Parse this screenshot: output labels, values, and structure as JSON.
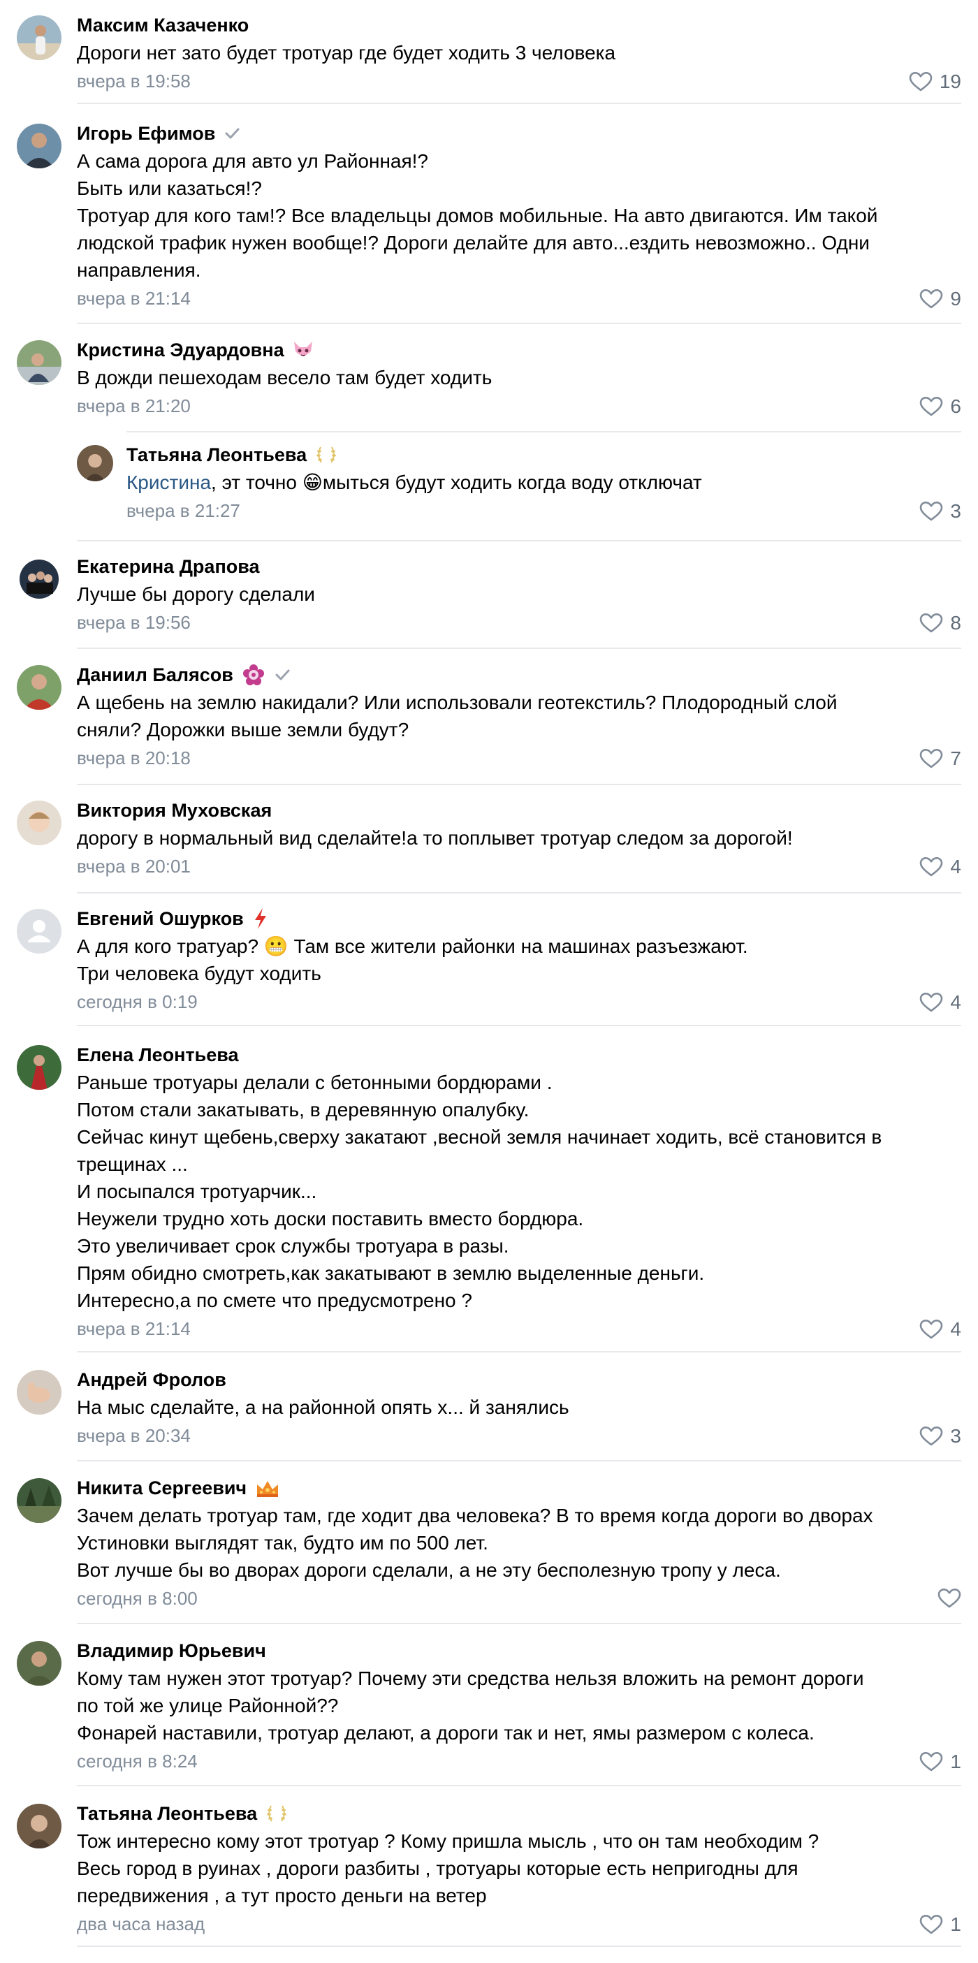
{
  "comments": [
    {
      "author": "Максим Казаченко",
      "text": "Дороги нет зато будет тротуар где будет ходить 3 человека",
      "time": "вчера в 19:58",
      "likes": "19",
      "avatar": "avatar-woman-beach"
    },
    {
      "author": "Игорь Ефимов",
      "verified": true,
      "text": "А сама дорога для авто ул Районная!?\nБыть или казаться!?\nТротуар для кого там!? Все владельцы домов мобильные. На авто двигаются. Им такой\nлюдской трафик нужен вообще!? Дороги делайте для авто...ездить невозможно.. Одни\nнаправления.",
      "time": "вчера в 21:14",
      "likes": "9",
      "avatar": "avatar-man-suit"
    },
    {
      "author": "Кристина Эдуардовна",
      "badge": "fox-mask-icon",
      "text": "В дожди пешеходам весело там будет ходить",
      "time": "вчера в 21:20",
      "likes": "6",
      "avatar": "avatar-woman-outdoor"
    },
    {
      "author": "Татьяна Леонтьева",
      "badge": "laurel-icon",
      "reply_to": "Кристина",
      "text": ", эт точно 😁мыться будут ходить когда воду отключат",
      "time": "вчера в 21:27",
      "likes": "3",
      "avatar": "avatar-woman-portrait",
      "reply": true
    },
    {
      "author": "Екатерина Драпова",
      "text": "Лучше бы дорогу сделали",
      "time": "вчера в 19:56",
      "likes": "8",
      "avatar": "avatar-group-photo"
    },
    {
      "author": "Даниил Балясов",
      "badge": "flower-badge-icon",
      "verified": true,
      "text": "А щебень на землю накидали? Или использовали геотекстиль? Плодородный слой\nсняли? Дорожки выше земли будут?",
      "time": "вчера в 20:18",
      "likes": "7",
      "avatar": "avatar-man-red"
    },
    {
      "author": "Виктория Муховская",
      "text": "дорогу в нормальный вид сделайте!а то поплывет тротуар следом за дорогой!",
      "time": "вчера в 20:01",
      "likes": "4",
      "avatar": "avatar-child"
    },
    {
      "author": "Евгений Ошурков",
      "badge": "lightning-icon",
      "text": "А для кого тратуар? 😬 Там все жители районки на машинах разъезжают.\nТри человека будут ходить",
      "time": "сегодня в 0:19",
      "likes": "4",
      "avatar": "avatar-placeholder"
    },
    {
      "author": "Елена Леонтьева",
      "text": "Раньше тротуары делали с бетонными бордюрами .\nПотом стали закатывать, в деревянную опалубку.\nСейчас кинут щебень,сверху закатают ,весной земля начинает ходить, всё становится в\nтрещинах ...\nИ посыпался тротуарчик...\nНеужели трудно хоть доски поставить вместо бордюра.\nЭто увеличивает срок службы тротуара в разы.\nПрям обидно смотреть,как закатывают в землю выделенные деньги.\nИнтересно,а по смете что предусмотрено ?",
      "time": "вчера в 21:14",
      "likes": "4",
      "avatar": "avatar-woman-red-dress"
    },
    {
      "author": "Андрей Фролов",
      "text": "На мыс сделайте, а на районной опять х... й занялись",
      "time": "вчера в 20:34",
      "likes": "3",
      "avatar": "avatar-hand"
    },
    {
      "author": "Никита Сергеевич",
      "badge": "crown-icon",
      "text": "Зачем делать тротуар там, где ходит два человека? В то время когда дороги во дворах\nУстиновки выглядят так, будто им по 500 лет.\nВот лучше бы во дворах дороги сделали, а не эту бесполезную тропу у леса.",
      "time": "сегодня в 8:00",
      "likes": "",
      "avatar": "avatar-forest"
    },
    {
      "author": "Владимир Юрьевич",
      "text": "Кому там нужен этот тротуар? Почему эти средства нельзя вложить на ремонт дороги\nпо той же улице Районной??\nФонарей наставили, тротуар делают, а дороги так и нет, ямы размером с колеса.",
      "time": "сегодня в 8:24",
      "likes": "1",
      "avatar": "avatar-man-military"
    },
    {
      "author": "Татьяна Леонтьева",
      "badge": "laurel-icon",
      "text": "Тож интересно кому этот тротуар ? Кому пришла мысль , что он там необходим ?\nВесь город в руинах , дороги разбиты , тротуары которые есть непригодны для\nпередвижения , а тут просто деньги на ветер",
      "time": "два часа назад",
      "likes": "1",
      "avatar": "avatar-woman-portrait"
    }
  ],
  "colors": {
    "link": "#2a5885",
    "meta": "#818c99",
    "separator": "#e7e8ec",
    "heart": "#818c99"
  }
}
